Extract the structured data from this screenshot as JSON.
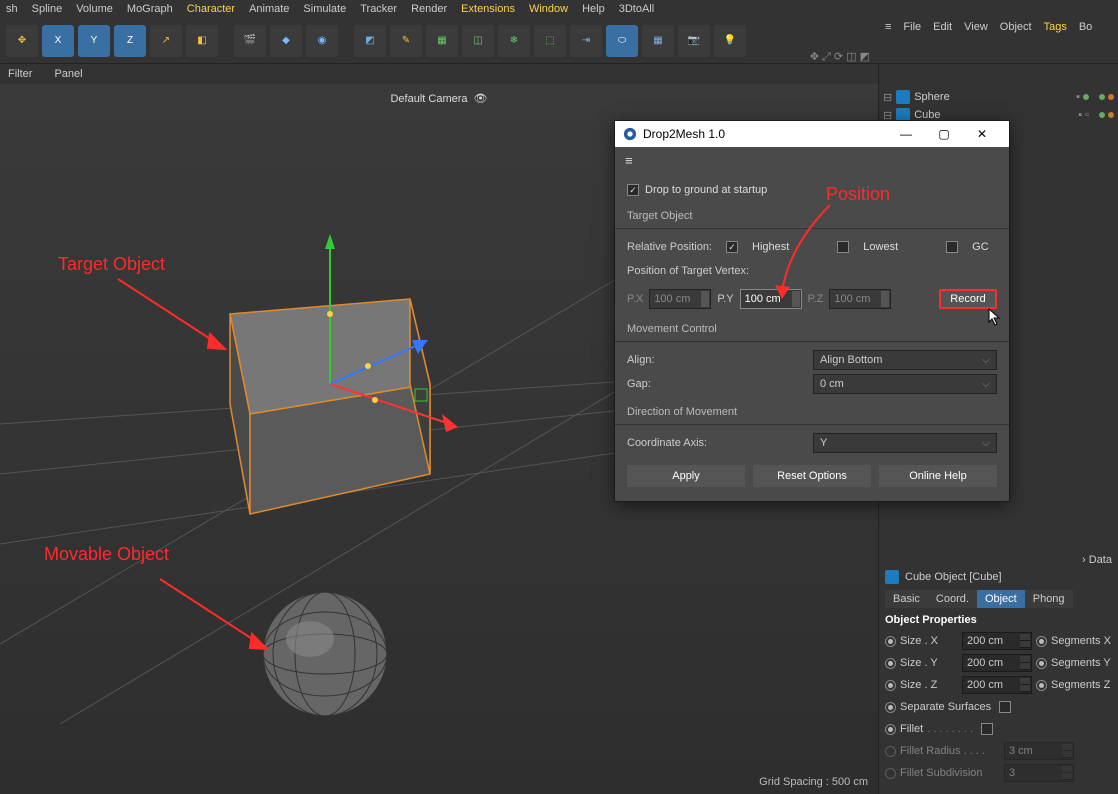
{
  "menu": [
    "sh",
    "Spline",
    "Volume",
    "MoGraph",
    "Character",
    "Animate",
    "Simulate",
    "Tracker",
    "Render",
    "Extensions",
    "Window",
    "Help",
    "3DtoAll"
  ],
  "menu_hl": [
    4,
    9,
    10
  ],
  "filter": {
    "a": "Filter",
    "b": "Panel"
  },
  "camera_label": "Default Camera",
  "grid_spacing": "Grid Spacing : 500 cm",
  "right_tabs": [
    "File",
    "Edit",
    "View",
    "Object",
    "Tags",
    "Bo"
  ],
  "right_tab_hl": 4,
  "menu_icon": "≡",
  "tree": [
    {
      "name": "Sphere"
    },
    {
      "name": "Cube"
    }
  ],
  "attr": {
    "udata": "Data",
    "title": "Cube Object [Cube]",
    "tabs": [
      "Basic",
      "Coord.",
      "Object",
      "Phong"
    ],
    "active_tab": 2,
    "section": "Object Properties",
    "size_x_l": "Size . X",
    "size_x_v": "200 cm",
    "seg_x_l": "Segments X",
    "size_y_l": "Size . Y",
    "size_y_v": "200 cm",
    "seg_y_l": "Segments Y",
    "size_z_l": "Size . Z",
    "size_z_v": "200 cm",
    "seg_z_l": "Segments Z",
    "sep_surf": "Separate Surfaces",
    "fillet": "Fillet",
    "fillet_dots": " . . . . . . . .",
    "fillet_r_l": "Fillet Radius . . . .",
    "fillet_r_v": "3 cm",
    "fillet_s_l": "Fillet Subdivision",
    "fillet_s_v": "3"
  },
  "dialog": {
    "title": "Drop2Mesh 1.0",
    "startup": "Drop to ground at startup",
    "target_obj": "Target Object",
    "rel_pos": "Relative Position:",
    "highest": "Highest",
    "lowest": "Lowest",
    "gc": "GC",
    "pos_of_vertex": "Position of Target Vertex:",
    "px": "P.X",
    "py": "P.Y",
    "pz": "P.Z",
    "v_px": "100 cm",
    "v_py": "100 cm",
    "v_pz": "100 cm",
    "record": "Record",
    "move_ctrl": "Movement Control",
    "align_l": "Align:",
    "align_v": "Align Bottom",
    "gap_l": "Gap:",
    "gap_v": "0 cm",
    "dir_move": "Direction of Movement",
    "axis_l": "Coordinate Axis:",
    "axis_v": "Y",
    "apply": "Apply",
    "reset": "Reset Options",
    "help": "Online Help"
  },
  "annot": {
    "target": "Target Object",
    "movable": "Movable Object",
    "position": "Position"
  }
}
